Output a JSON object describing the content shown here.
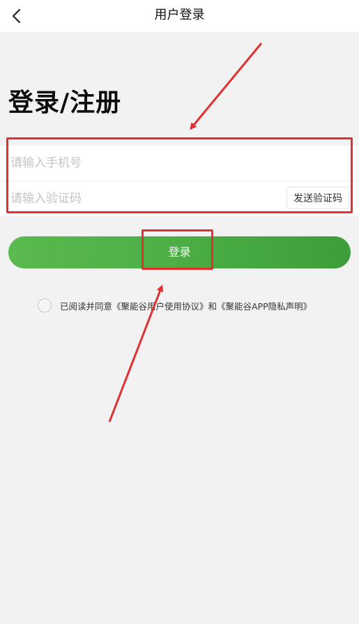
{
  "nav": {
    "title": "用户登录",
    "back_icon": "chevron-left-icon"
  },
  "heading": "登录/注册",
  "form": {
    "phone_placeholder": "请输入手机号",
    "code_placeholder": "请输入验证码",
    "send_code_label": "发送验证码"
  },
  "login_button": "登录",
  "agreement": {
    "prefix": "已阅读并同意",
    "user_agreement": "《聚能谷用户使用协议》",
    "conjunction": "和",
    "privacy_policy": "《聚能谷APP隐私声明》"
  },
  "colors": {
    "primary_green": "#4caf4f",
    "annotation_red": "#e03030"
  }
}
